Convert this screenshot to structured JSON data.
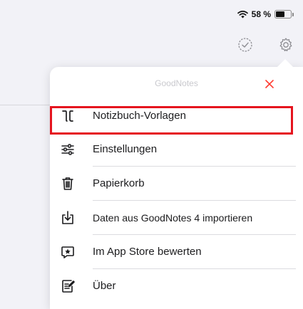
{
  "status": {
    "battery_percent_text": "58 %",
    "battery_level": 0.58
  },
  "popover": {
    "title": "GoodNotes",
    "close_color": "#ff3b30",
    "items": [
      {
        "label": "Notizbuch-Vorlagen",
        "icon": "template-icon",
        "highlighted": true
      },
      {
        "label": "Einstellungen",
        "icon": "sliders-icon"
      },
      {
        "label": "Papierkorb",
        "icon": "trash-icon"
      },
      {
        "label": "Daten aus GoodNotes 4 importieren",
        "icon": "import-icon"
      },
      {
        "label": "Im App Store bewerten",
        "icon": "star-bubble-icon"
      },
      {
        "label": "Über",
        "icon": "info-note-icon"
      }
    ]
  },
  "colors": {
    "highlight_border": "#e5141e",
    "background": "#f2f2f7"
  }
}
